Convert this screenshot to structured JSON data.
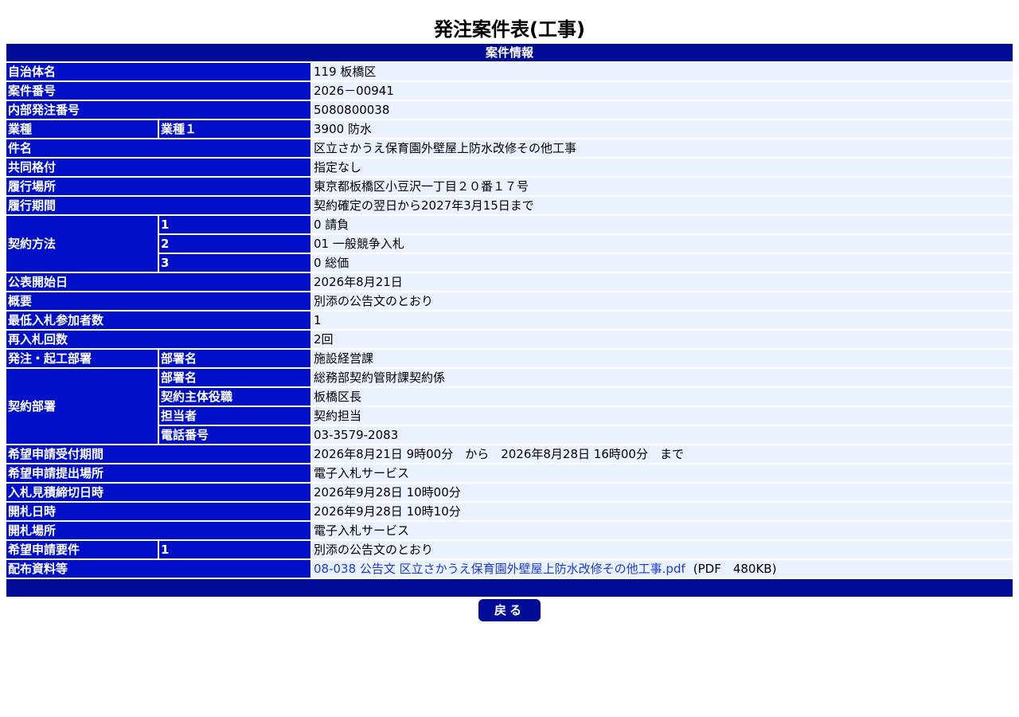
{
  "page_title": "発注案件表(工事)",
  "section_header": "案件情報",
  "rows": {
    "municipality": {
      "label": "自治体名",
      "value": "119 板橋区"
    },
    "case_no": {
      "label": "案件番号",
      "value": "2026－00941"
    },
    "internal_no": {
      "label": "内部発注番号",
      "value": "5080800038"
    },
    "industry": {
      "label": "業種",
      "sub_label": "業種１",
      "value": "3900 防水"
    },
    "subject": {
      "label": "件名",
      "value": "区立さかうえ保育園外壁屋上防水改修その他工事"
    },
    "joint_rating": {
      "label": "共同格付",
      "value": "指定なし"
    },
    "location": {
      "label": "履行場所",
      "value": "東京都板橋区小豆沢一丁目２０番１７号"
    },
    "period": {
      "label": "履行期間",
      "value": "契約確定の翌日から2027年3月15日まで"
    },
    "contract_method": {
      "label": "契約方法",
      "items": [
        {
          "sub_label": "1",
          "value": "0 請負"
        },
        {
          "sub_label": "2",
          "value": "01 一般競争入札"
        },
        {
          "sub_label": "3",
          "value": "0 総価"
        }
      ]
    },
    "publish_date": {
      "label": "公表開始日",
      "value": "2026年8月21日"
    },
    "summary": {
      "label": "概要",
      "value": "別添の公告文のとおり"
    },
    "min_bidders": {
      "label": "最低入札参加者数",
      "value": "1"
    },
    "rebid_count": {
      "label": "再入札回数",
      "value": "2回"
    },
    "ordering_dept": {
      "label": "発注・起工部署",
      "sub_label": "部署名",
      "value": "施設経営課"
    },
    "contract_dept": {
      "label": "契約部署",
      "items": [
        {
          "sub_label": "部署名",
          "value": "総務部契約管財課契約係"
        },
        {
          "sub_label": "契約主体役職",
          "value": "板橋区長"
        },
        {
          "sub_label": "担当者",
          "value": "契約担当"
        },
        {
          "sub_label": "電話番号",
          "value": "03-3579-2083"
        }
      ]
    },
    "application_period": {
      "label": "希望申請受付期間",
      "value": "2026年8月21日 9時00分　から　2026年8月28日 16時00分　まで"
    },
    "application_place": {
      "label": "希望申請提出場所",
      "value": "電子入札サービス"
    },
    "bid_deadline": {
      "label": "入札見積締切日時",
      "value": "2026年9月28日 10時00分"
    },
    "opening_datetime": {
      "label": "開札日時",
      "value": "2026年9月28日 10時10分"
    },
    "opening_place": {
      "label": "開札場所",
      "value": "電子入札サービス"
    },
    "application_requirements": {
      "label": "希望申請要件",
      "sub_label": "1",
      "value": "別添の公告文のとおり"
    },
    "documents": {
      "label": "配布資料等",
      "link_text": "08-038 公告文 区立さかうえ保育園外壁屋上防水改修その他工事.pdf",
      "file_info": "(PDF　480KB)"
    }
  },
  "back_button": "戻る",
  "colors": {
    "header_bg": "#000c96",
    "label_bg": "#0010c8",
    "value_bg": "#eaf2ff",
    "link": "#1a3bd1"
  }
}
